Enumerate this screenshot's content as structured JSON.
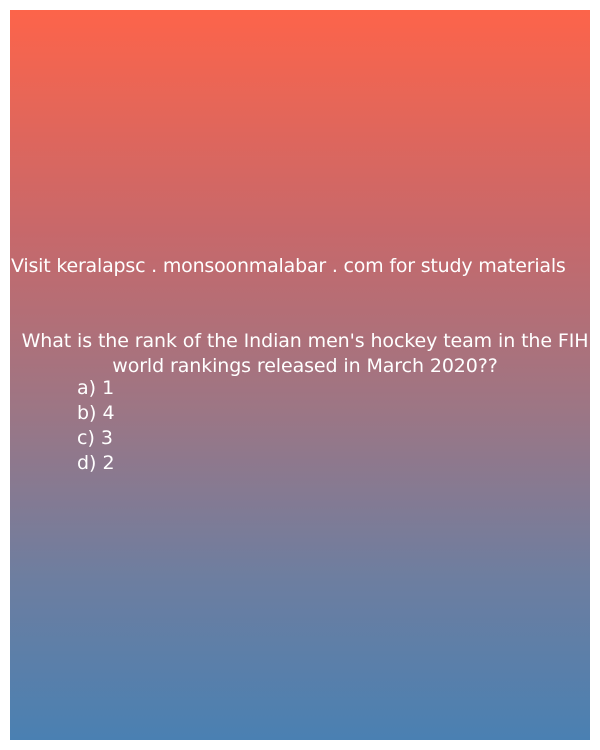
{
  "visit_text": "Visit keralapsc . monsoonmalabar . com for study materials",
  "question": "What is the rank of the Indian men's hockey team in the FIH world rankings released in March 2020??",
  "options": [
    "a) 1",
    "b) 4",
    "c) 3",
    "d) 2"
  ],
  "colors": {
    "gradient_top": "#fd644a",
    "gradient_bottom": "#4a80b2",
    "text": "#ffffff"
  }
}
